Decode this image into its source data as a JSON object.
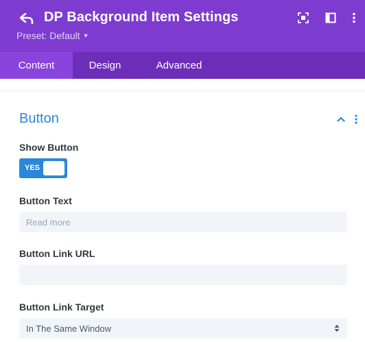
{
  "header": {
    "title": "DP Background Item Settings",
    "preset_label": "Preset: Default",
    "icons": [
      "back-arrow-icon",
      "screenshot-frame-icon",
      "sidebar-layout-icon",
      "kebab-menu-icon",
      "caret-down-icon"
    ]
  },
  "tabs": [
    {
      "label": "Content",
      "active": true
    },
    {
      "label": "Design",
      "active": false
    },
    {
      "label": "Advanced",
      "active": false
    }
  ],
  "section": {
    "title": "Button",
    "expanded": true,
    "icons": [
      "chevron-up-icon",
      "kebab-menu-icon"
    ]
  },
  "fields": {
    "show_button": {
      "label": "Show Button",
      "toggle_text": "YES",
      "checked": true
    },
    "button_text": {
      "label": "Button Text",
      "value": "",
      "placeholder": "Read more"
    },
    "button_link_url": {
      "label": "Button Link URL",
      "value": "",
      "placeholder": ""
    },
    "button_link_target": {
      "label": "Button Link Target",
      "selected": "In The Same Window",
      "icon": "select-arrows-icon"
    }
  },
  "colors": {
    "header_bg": "#7e3bd0",
    "tabs_bg": "#6c2eb9",
    "active_tab_bg": "#8a43dd",
    "accent_blue": "#2b87da",
    "field_bg": "#f1f5f9"
  }
}
